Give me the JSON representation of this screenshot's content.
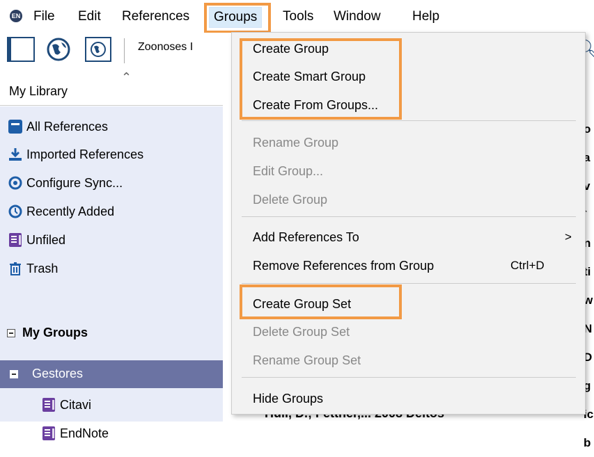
{
  "menubar": {
    "logo": "EN",
    "items": [
      "File",
      "Edit",
      "References",
      "Groups",
      "Tools",
      "Window",
      "Help"
    ]
  },
  "toolbar": {
    "style_text": "Zoonoses I"
  },
  "library": {
    "tab_label": "My Library",
    "items": [
      {
        "label": "All References",
        "icon": "all-references-icon"
      },
      {
        "label": "Imported References",
        "icon": "download-icon"
      },
      {
        "label": "Configure Sync...",
        "icon": "sync-icon"
      },
      {
        "label": "Recently Added",
        "icon": "clock-icon"
      },
      {
        "label": "Unfiled",
        "icon": "unfiled-icon"
      },
      {
        "label": "Trash",
        "icon": "trash-icon"
      }
    ],
    "my_groups_label": "My Groups",
    "group_set": {
      "label": "Gestores",
      "children": [
        "Citavi",
        "EndNote"
      ]
    }
  },
  "groups_menu": {
    "create_group": "Create Group",
    "create_smart_group": "Create Smart Group",
    "create_from_groups": "Create From Groups...",
    "rename_group": "Rename Group",
    "edit_group": "Edit Group...",
    "delete_group": "Delete Group",
    "add_references_to": "Add References To",
    "add_references_arrow": ">",
    "remove_references": "Remove References from Group",
    "remove_shortcut": "Ctrl+D",
    "create_group_set": "Create Group Set",
    "delete_group_set": "Delete Group Set",
    "rename_group_set": "Rename Group Set",
    "hide_groups": "Hide Groups"
  },
  "reference_list": {
    "edge_letters": [
      "o",
      "a",
      "v",
      "`",
      "n",
      "ti",
      "w",
      "N",
      "D",
      "g",
      "ic",
      "b"
    ],
    "bottom_row": "Hull, D.; Fettner,...   2008   Deltos"
  },
  "colors": {
    "highlight": "#f29a45",
    "selection": "#6b73a3",
    "sidebar_bg": "#e8ecf8",
    "icon_blue": "#1e5ea8",
    "icon_purple": "#6b3fa0"
  }
}
